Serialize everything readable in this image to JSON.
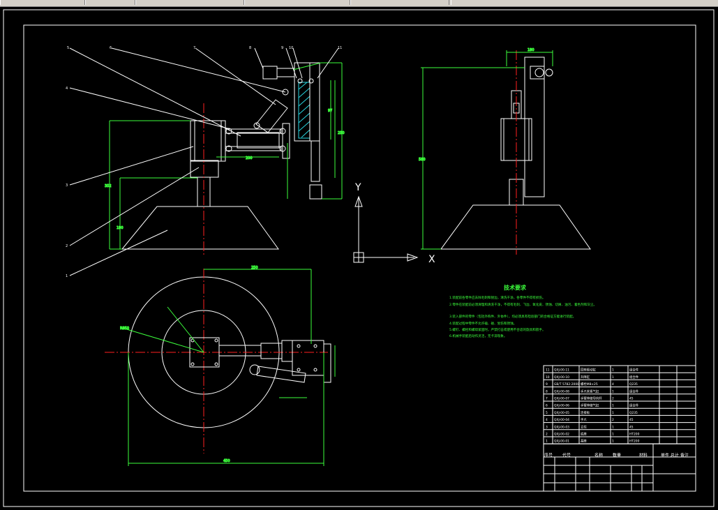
{
  "window": {
    "toolbar_segments": 6
  },
  "drawing": {
    "technical_requirements": {
      "title": "技术要求",
      "items": [
        "1.装配前各零件应去除毛刺和锐边，清洗干净，各零件不得有损伤。",
        "2.零件在装配前必须清理和清洗干净，不得有毛刺、飞边、氧化皮、锈蚀、切屑、油污、着色剂和灰尘。",
        "3.装入部件的零件（包括外购件、外协件），均必须具有检验部门的合格证方能进行装配。",
        "4.装配过程中零件不允许磕、碰、划伤和锈蚀。",
        "5.螺钉、螺栓和螺母紧固时，严禁打击或使用不合适的旋具和扳手。",
        "6.机械手装配后动作灵活，无卡滞现象。"
      ]
    },
    "balloons": [
      "1",
      "2",
      "3",
      "4",
      "5",
      "6",
      "7",
      "8",
      "9",
      "10",
      "11"
    ],
    "axes": {
      "y_label": "Y",
      "x_label": "X"
    },
    "bom": {
      "rows": [
        {
          "no": "11",
          "code": "QXJ-00-11",
          "name": "回转驱动缸",
          "qty": "1",
          "material": "组合件"
        },
        {
          "no": "10",
          "code": "QXJ-00-10",
          "name": "升降缸",
          "qty": "1",
          "material": "组合件"
        },
        {
          "no": "9",
          "code": "GB/T 5782-2000",
          "name": "螺栓M8×25",
          "qty": "4",
          "material": "Q235"
        },
        {
          "no": "8",
          "code": "QXJ-00-08",
          "name": "手爪夹紧气缸",
          "qty": "1",
          "material": "组合件"
        },
        {
          "no": "7",
          "code": "QXJ-00-07",
          "name": "手臂伸缩导向杆",
          "qty": "2",
          "material": "45"
        },
        {
          "no": "6",
          "code": "QXJ-00-06",
          "name": "手臂伸缩气缸",
          "qty": "1",
          "material": "组合件"
        },
        {
          "no": "5",
          "code": "QXJ-00-05",
          "name": "连接板",
          "qty": "1",
          "material": "Q235"
        },
        {
          "no": "4",
          "code": "QXJ-00-04",
          "name": "手爪",
          "qty": "2",
          "material": "45"
        },
        {
          "no": "3",
          "code": "QXJ-00-03",
          "name": "立柱",
          "qty": "1",
          "material": "45"
        },
        {
          "no": "2",
          "code": "QXJ-00-02",
          "name": "底座",
          "qty": "1",
          "material": "HT200"
        },
        {
          "no": "1",
          "code": "QXJ-00-01",
          "name": "基座",
          "qty": "1",
          "material": "HT200"
        }
      ],
      "header": {
        "no": "序号",
        "code": "代号",
        "name": "名称",
        "qty": "数量",
        "material": "材料",
        "weight": "单件 总计",
        "remark": "备注"
      }
    }
  }
}
